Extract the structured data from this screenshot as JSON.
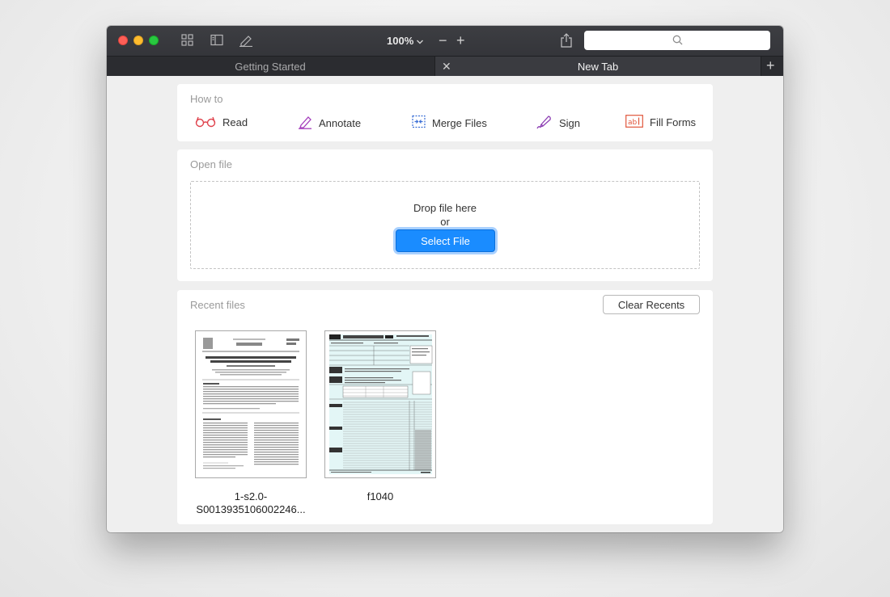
{
  "toolbar": {
    "zoom_label": "100%",
    "zoom_out_symbol": "−",
    "zoom_in_symbol": "+",
    "search_placeholder": ""
  },
  "tabs": [
    {
      "label": "Getting Started",
      "active": false
    },
    {
      "label": "New Tab",
      "active": true
    }
  ],
  "tab_close_symbol": "✕",
  "tab_add_symbol": "+",
  "howto": {
    "title": "How to",
    "actions": [
      {
        "label": "Read",
        "icon": "glasses-icon"
      },
      {
        "label": "Annotate",
        "icon": "pen-icon"
      },
      {
        "label": "Merge Files",
        "icon": "merge-icon"
      },
      {
        "label": "Sign",
        "icon": "signature-pen-icon"
      },
      {
        "label": "Fill Forms",
        "icon": "form-field-icon"
      }
    ]
  },
  "openfile": {
    "title": "Open file",
    "drop_text": "Drop file here",
    "or_text": "or",
    "select_button": "Select File"
  },
  "recent": {
    "title": "Recent files",
    "clear_button": "Clear Recents",
    "files": [
      {
        "name_line1": "1-s2.0-",
        "name_line2": "S0013935106002246..."
      },
      {
        "name_line1": "f1040",
        "name_line2": ""
      }
    ]
  },
  "colors": {
    "accent": "#1a8cff",
    "read_icon": "#e0444e",
    "annotate_icon": "#a43dbc",
    "merge_icon": "#3b6fd6",
    "sign_icon": "#8d3fb3",
    "forms_icon": "#e0553b"
  }
}
